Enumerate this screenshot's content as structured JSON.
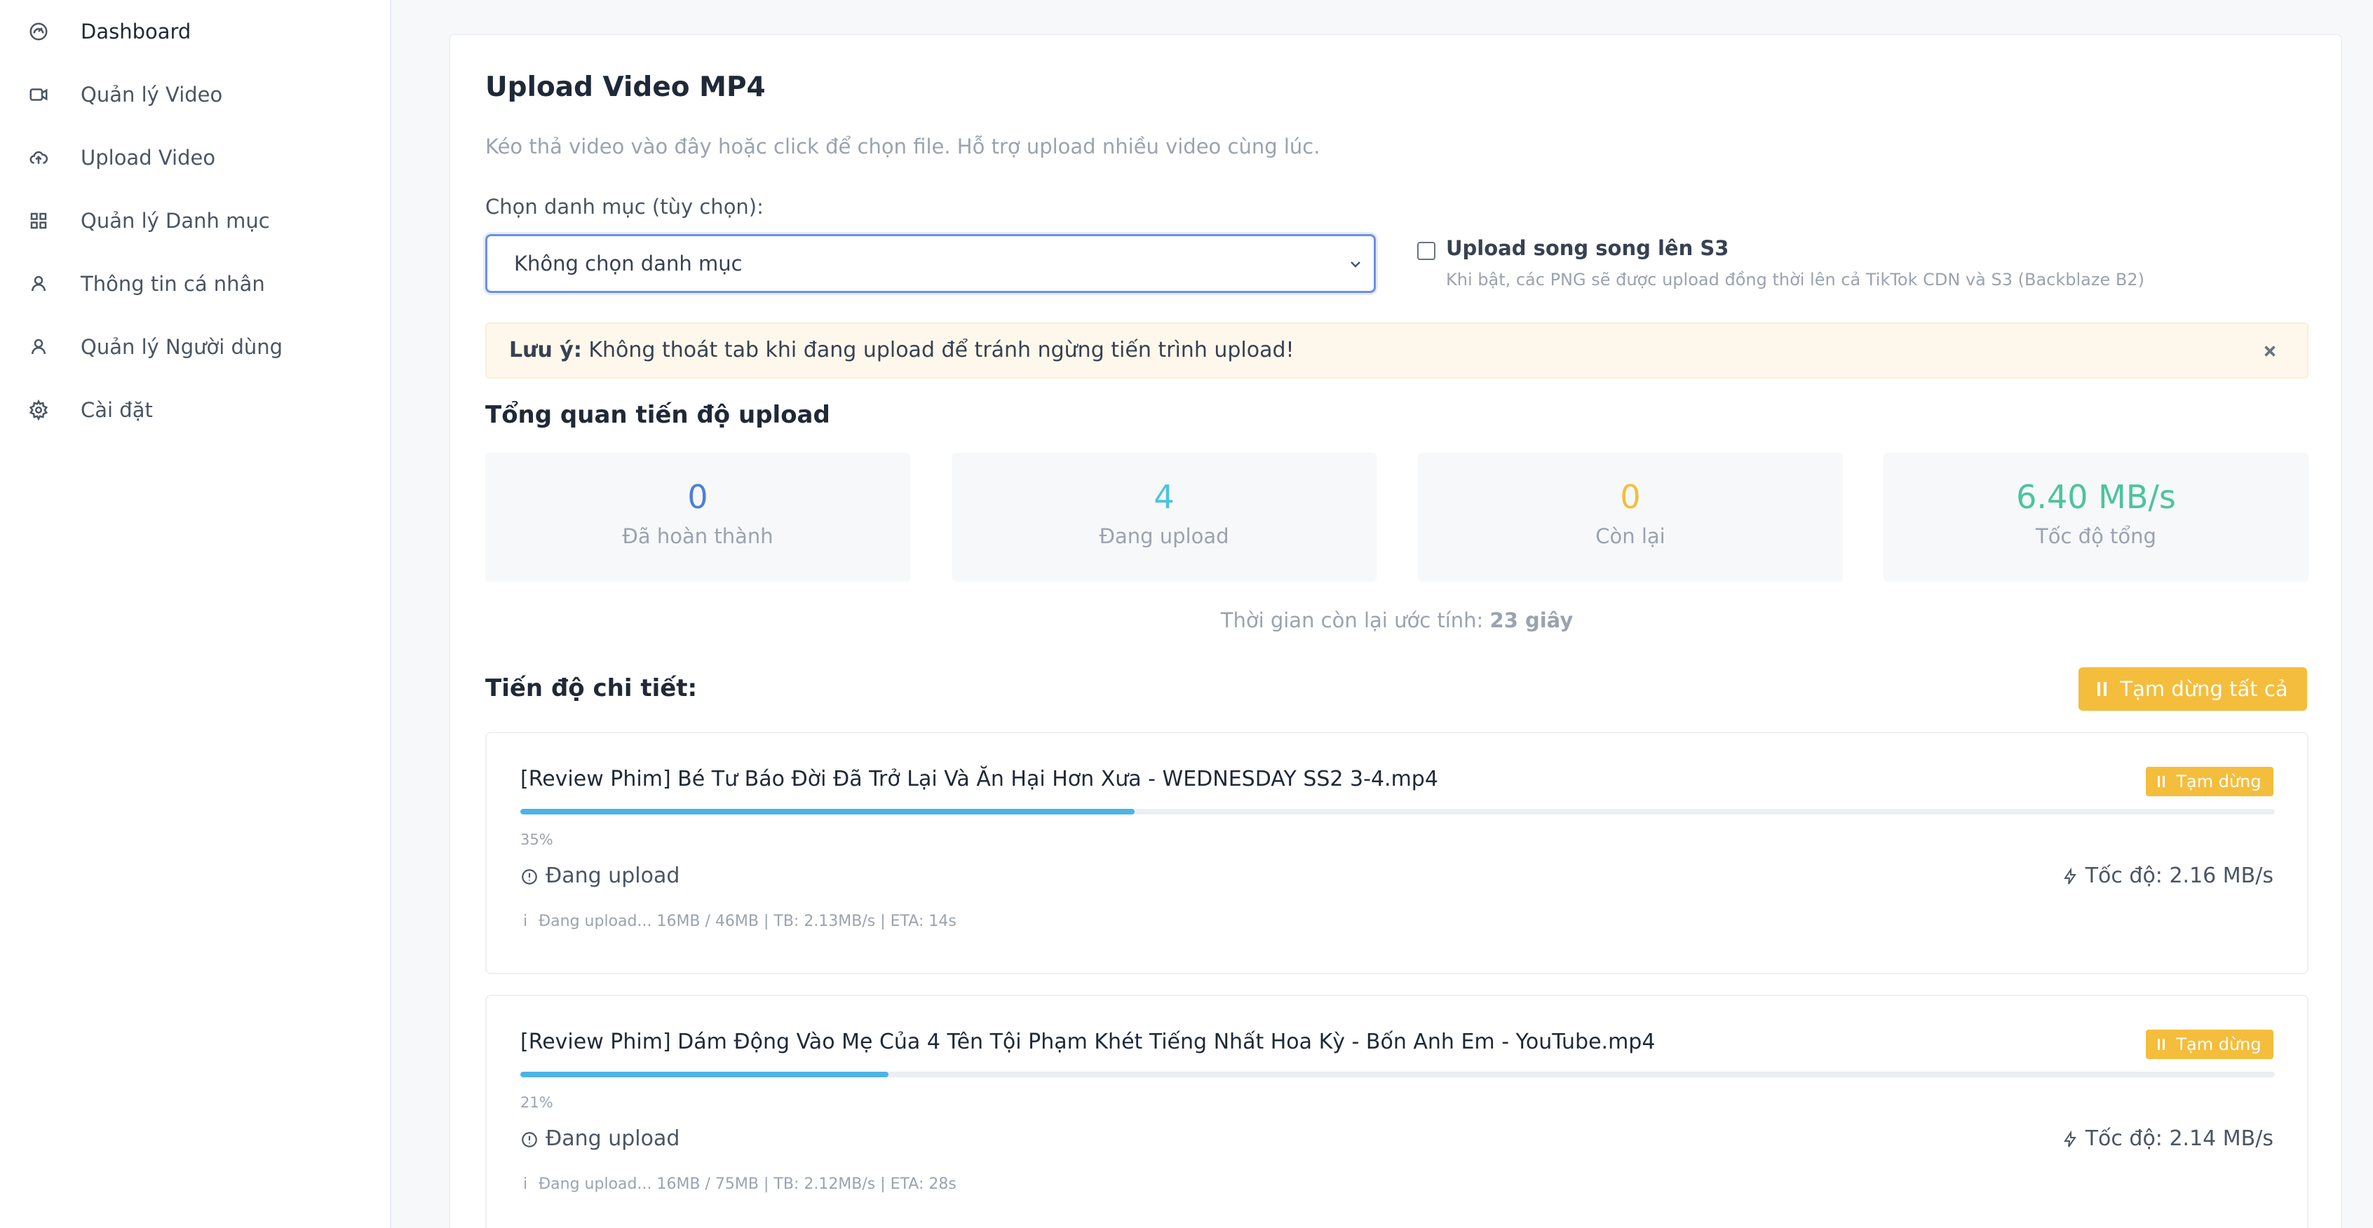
{
  "sidebar": {
    "items": [
      {
        "label": "Dashboard",
        "icon": "dashboard-gauge-icon"
      },
      {
        "label": "Quản lý Video",
        "icon": "video-camera-icon"
      },
      {
        "label": "Upload Video",
        "icon": "cloud-upload-icon"
      },
      {
        "label": "Quản lý Danh mục",
        "icon": "grid-icon"
      },
      {
        "label": "Thông tin cá nhân",
        "icon": "user-icon"
      },
      {
        "label": "Quản lý Người dùng",
        "icon": "user-icon"
      },
      {
        "label": "Cài đặt",
        "icon": "gear-icon"
      }
    ]
  },
  "upload": {
    "title": "Upload Video MP4",
    "subtitle": "Kéo thả video vào đây hoặc click để chọn file. Hỗ trợ upload nhiều video cùng lúc.",
    "category_label": "Chọn danh mục (tùy chọn):",
    "category_value": "Không chọn danh mục",
    "s3_label": "Upload song song lên S3",
    "s3_help": "Khi bật, các PNG sẽ được upload đồng thời lên cả TikTok CDN và S3 (Backblaze B2)",
    "s3_checked": false
  },
  "alert": {
    "bold": "Lưu ý:",
    "text": " Không thoát tab khi đang upload để tránh ngừng tiến trình upload!"
  },
  "overview": {
    "title": "Tổng quan tiến độ upload",
    "stats": [
      {
        "value": "0",
        "label": "Đã hoàn thành",
        "color": "#4e7fd8"
      },
      {
        "value": "4",
        "label": "Đang upload",
        "color": "#4cc3e0"
      },
      {
        "value": "0",
        "label": "Còn lại",
        "color": "#f4bd3c"
      },
      {
        "value": "6.40 MB/s",
        "label": "Tốc độ tổng",
        "color": "#4cc49a"
      }
    ],
    "eta_label": "Thời gian còn lại ước tính: ",
    "eta_value": "23 giây"
  },
  "details": {
    "title": "Tiến độ chi tiết:",
    "pause_all": "Tạm dừng tất cả",
    "files": [
      {
        "name": "[Review Phim] Bé Tư Báo Đời Đã Trở Lại Và Ăn Hại Hơn Xưa - WEDNESDAY SS2 3-4.mp4",
        "pause": "Tạm dừng",
        "progress": 0.35,
        "percent": "35%",
        "status": "Đang upload",
        "speed_label": "Tốc độ:",
        "speed_value": "2.16 MB/s",
        "info_glyph": "i",
        "detail": "Đang upload... 16MB / 46MB | TB: 2.13MB/s | ETA: 14s"
      },
      {
        "name": "[Review Phim] Dám Động Vào Mẹ Của 4 Tên Tội Phạm Khét Tiếng Nhất Hoa Kỳ - Bốn Anh Em - YouTube.mp4",
        "pause": "Tạm dừng",
        "progress": 0.21,
        "percent": "21%",
        "status": "Đang upload",
        "speed_label": "Tốc độ:",
        "speed_value": "2.14 MB/s",
        "info_glyph": "i",
        "detail": "Đang upload... 16MB / 75MB | TB: 2.12MB/s | ETA: 28s"
      }
    ]
  }
}
